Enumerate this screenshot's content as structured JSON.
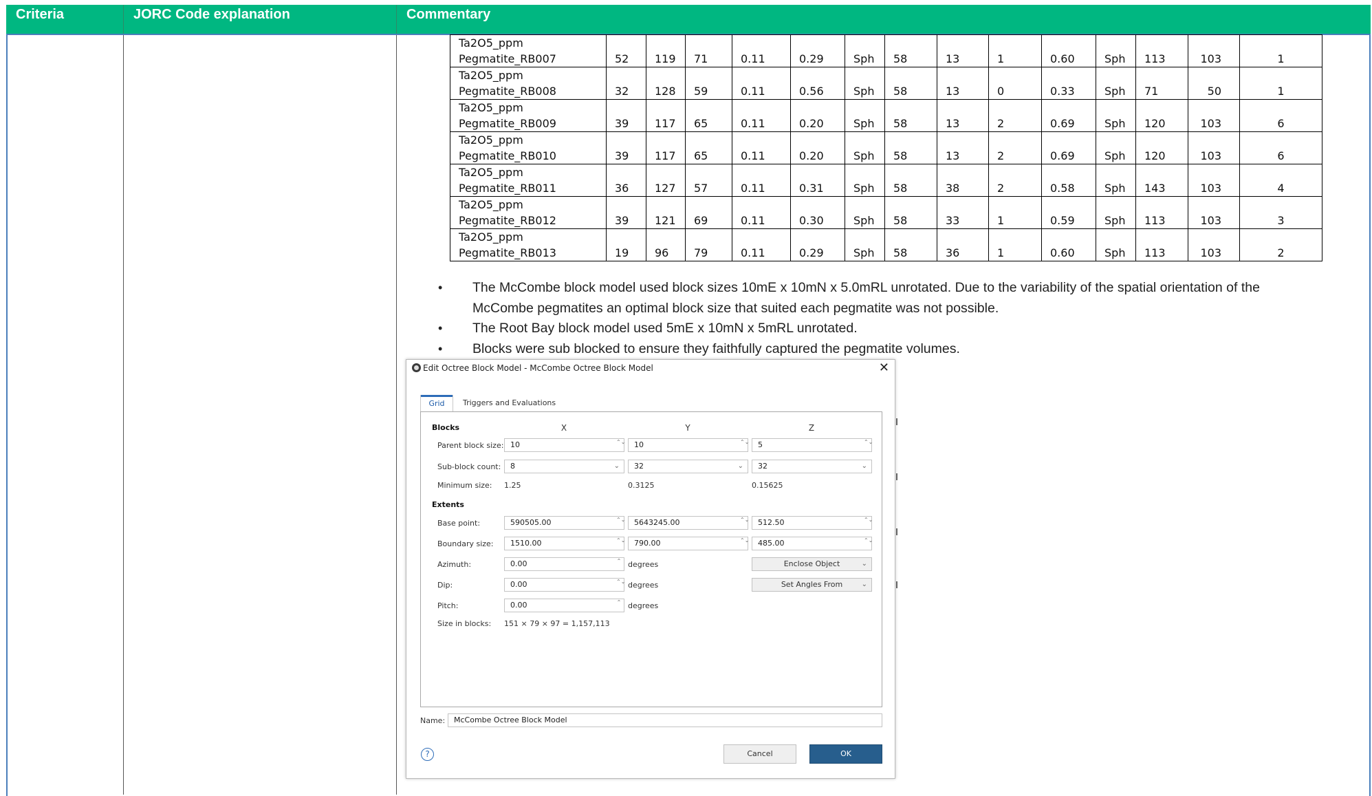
{
  "header": {
    "col1": "Criteria",
    "col2": "JORC Code explanation",
    "col3": "Commentary"
  },
  "table": {
    "rows": [
      {
        "l1": "Ta2O5_ppm",
        "l2": "Pegmatite_RB007",
        "v": [
          "52",
          "119",
          "71",
          "0.11",
          "0.29",
          "Sph",
          "58",
          "13",
          "1",
          "0.60",
          "Sph",
          "113",
          "103",
          "1"
        ]
      },
      {
        "l1": "Ta2O5_ppm",
        "l2": "Pegmatite_RB008",
        "v": [
          "32",
          "128",
          "59",
          "0.11",
          "0.56",
          "Sph",
          "58",
          "13",
          "0",
          "0.33",
          "Sph",
          "71",
          "50",
          "1"
        ]
      },
      {
        "l1": "Ta2O5_ppm",
        "l2": "Pegmatite_RB009",
        "v": [
          "39",
          "117",
          "65",
          "0.11",
          "0.20",
          "Sph",
          "58",
          "13",
          "2",
          "0.69",
          "Sph",
          "120",
          "103",
          "6"
        ]
      },
      {
        "l1": "Ta2O5_ppm",
        "l2": "Pegmatite_RB010",
        "v": [
          "39",
          "117",
          "65",
          "0.11",
          "0.20",
          "Sph",
          "58",
          "13",
          "2",
          "0.69",
          "Sph",
          "120",
          "103",
          "6"
        ]
      },
      {
        "l1": "Ta2O5_ppm",
        "l2": "Pegmatite_RB011",
        "v": [
          "36",
          "127",
          "57",
          "0.11",
          "0.31",
          "Sph",
          "58",
          "38",
          "2",
          "0.58",
          "Sph",
          "143",
          "103",
          "4"
        ]
      },
      {
        "l1": "Ta2O5_ppm",
        "l2": "Pegmatite_RB012",
        "v": [
          "39",
          "121",
          "69",
          "0.11",
          "0.30",
          "Sph",
          "58",
          "33",
          "1",
          "0.59",
          "Sph",
          "113",
          "103",
          "3"
        ]
      },
      {
        "l1": "Ta2O5_ppm",
        "l2": "Pegmatite_RB013",
        "v": [
          "19",
          "96",
          "79",
          "0.11",
          "0.29",
          "Sph",
          "58",
          "36",
          "1",
          "0.60",
          "Sph",
          "113",
          "103",
          "2"
        ]
      }
    ]
  },
  "bullets": [
    "The McCombe block model used block sizes 10mE x 10mN x 5.0mRL unrotated. Due to the variability of the spatial orientation of the McCombe pegmatites an optimal block size that suited each pegmatite was not possible.",
    "The Root Bay block model used 5mE x 10mN x 5mRL unrotated.",
    "Blocks were sub blocked to ensure they faithfully captured the pegmatite volumes."
  ],
  "bullet_glyph": "•",
  "dialog": {
    "title": "Edit Octree Block Model - McCombe Octree Block Model",
    "close_glyph": "✕",
    "tabs": [
      "Grid",
      "Triggers and Evaluations"
    ],
    "blocks_heading": "Blocks",
    "col_x": "X",
    "col_y": "Y",
    "col_z": "Z",
    "parent_block_size_label": "Parent block size:",
    "parent_block_size": [
      "10",
      "10",
      "5"
    ],
    "sub_block_count_label": "Sub-block count:",
    "sub_block_count": [
      "8",
      "32",
      "32"
    ],
    "minimum_size_label": "Minimum size:",
    "minimum_size": [
      "1.25",
      "0.3125",
      "0.15625"
    ],
    "extents_heading": "Extents",
    "base_point_label": "Base point:",
    "base_point": [
      "590505.00",
      "5643245.00",
      "512.50"
    ],
    "boundary_size_label": "Boundary size:",
    "boundary_size": [
      "1510.00",
      "790.00",
      "485.00"
    ],
    "azimuth_label": "Azimuth:",
    "azimuth": "0.00",
    "dip_label": "Dip:",
    "dip": "0.00",
    "pitch_label": "Pitch:",
    "pitch": "0.00",
    "degrees": "degrees",
    "enclose_object": "Enclose Object",
    "set_angles_from": "Set Angles From",
    "size_in_blocks_label": "Size in blocks:",
    "size_in_blocks": "151 × 79 × 97 = 1,157,113",
    "name_label": "Name:",
    "name_value": "McCombe Octree Block Model",
    "help_glyph": "?",
    "cancel": "Cancel",
    "ok": "OK"
  },
  "icons": {
    "spin": "⌃⌄",
    "spin_up": "⌃",
    "dropdown": "⌄"
  }
}
